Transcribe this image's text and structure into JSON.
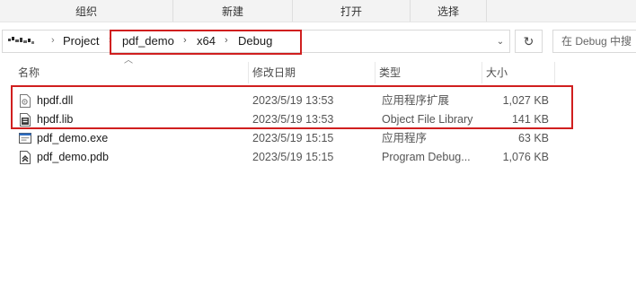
{
  "ribbon": {
    "groups": [
      "组织",
      "新建",
      "打开",
      "选择"
    ]
  },
  "address": {
    "breadcrumbs": [
      "Project",
      "pdf_demo",
      "x64",
      "Debug"
    ],
    "search_placeholder": "在 Debug 中搜"
  },
  "columns": {
    "name": "名称",
    "date": "修改日期",
    "type": "类型",
    "size": "大小"
  },
  "files": [
    {
      "name": "hpdf.dll",
      "date": "2023/5/19 13:53",
      "type": "应用程序扩展",
      "size": "1,027 KB",
      "icon": "dll-file-icon"
    },
    {
      "name": "hpdf.lib",
      "date": "2023/5/19 13:53",
      "type": "Object File Library",
      "size": "141 KB",
      "icon": "lib-file-icon"
    },
    {
      "name": "pdf_demo.exe",
      "date": "2023/5/19 15:15",
      "type": "应用程序",
      "size": "63 KB",
      "icon": "exe-file-icon"
    },
    {
      "name": "pdf_demo.pdb",
      "date": "2023/5/19 15:15",
      "type": "Program Debug...",
      "size": "1,076 KB",
      "icon": "pdb-file-icon"
    }
  ],
  "highlight_color": "#d01f1f"
}
